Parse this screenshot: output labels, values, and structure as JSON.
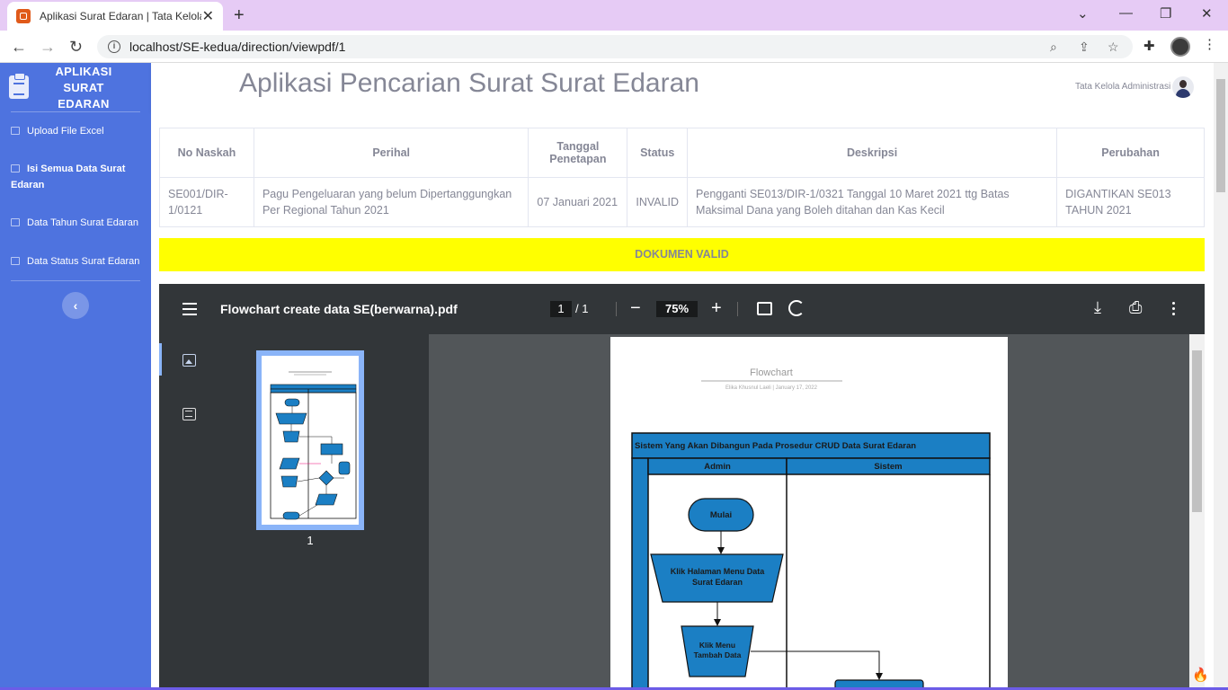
{
  "browser": {
    "tab_title": "Aplikasi Surat Edaran | Tata Kelola Administrasi",
    "tab_close": "✕",
    "new_tab": "+",
    "url": "localhost/SE-kedua/direction/viewpdf/1",
    "info": "i"
  },
  "sidebar": {
    "brand": "APLIKASI SURAT EDARAN",
    "collapse": "‹",
    "items": [
      {
        "label": "Upload File Excel"
      },
      {
        "label": "Isi Semua Data Surat Edaran"
      },
      {
        "label": "Data Tahun Surat Edaran"
      },
      {
        "label": "Data Status Surat Edaran"
      }
    ]
  },
  "header": {
    "title": "Aplikasi Pencarian Surat Surat Edaran",
    "user": "Tata Kelola Administrasi"
  },
  "table": {
    "columns": [
      "No Naskah",
      "Perihal",
      "Tanggal Penetapan",
      "Status",
      "Deskripsi",
      "Perubahan"
    ],
    "row": {
      "no_naskah": "SE001/DIR-1/0121",
      "perihal": "Pagu Pengeluaran yang belum Dipertanggungkan Per Regional Tahun 2021",
      "tanggal": "07 Januari 2021",
      "status": "INVALID",
      "deskripsi": "Pengganti SE013/DIR-1/0321 Tanggal 10 Maret 2021 ttg Batas Maksimal Dana yang Boleh ditahan dan Kas Kecil",
      "perubahan": "DIGANTIKAN SE013 TAHUN 2021"
    }
  },
  "banner": {
    "text": "DOKUMEN VALID",
    "color": "#ffff00"
  },
  "pdf": {
    "filename": "Flowchart create data SE(berwarna).pdf",
    "page_current": "1",
    "page_total": "/  1",
    "zoom": "75%",
    "zoom_out": "−",
    "zoom_in": "+",
    "thumbnail_label": "1",
    "doc": {
      "title": "Flowchart",
      "subtitle": "Elika Khusnul Laeli  |  January 17, 2022",
      "pool_title": "Sistem Yang Akan Dibangun Pada Prosedur CRUD Data Surat Edaran",
      "lane_admin": "Admin",
      "lane_sistem": "Sistem",
      "step_start": "Mulai",
      "step_menu_line1": "Klik Halaman Menu Data",
      "step_menu_line2": "Surat Edaran",
      "step_tambah_line1": "Klik Menu",
      "step_tambah_line2": "Tambah Data"
    }
  },
  "colors": {
    "sidebar": "#4e73df",
    "pdf_toolbar": "#323639",
    "flow_blue": "#1b7fc4",
    "tab_bar": "#e6cbf5"
  }
}
